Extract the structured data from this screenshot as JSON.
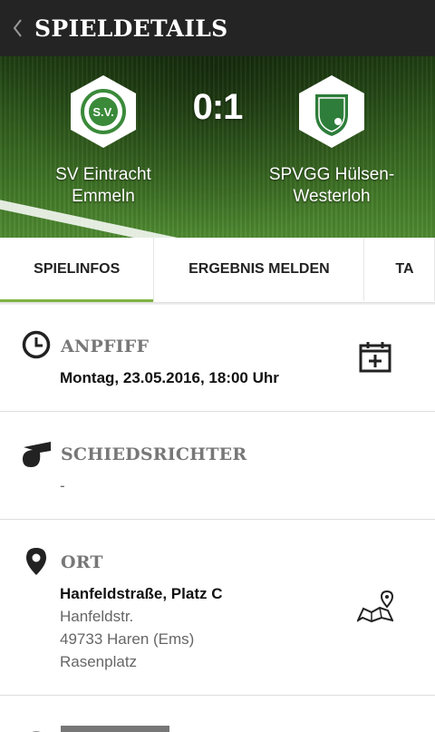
{
  "header": {
    "back_icon": "chevron-left-icon",
    "title": "SPIELDETAILS"
  },
  "match": {
    "home": {
      "name_line1": "SV Eintracht",
      "name_line2": "Emmeln",
      "crest_text": "S.V."
    },
    "away": {
      "name_line1": "SPVGG Hülsen-",
      "name_line2": "Westerloh"
    },
    "score": "0:1"
  },
  "tabs": [
    {
      "label": "SPIELINFOS",
      "active": true
    },
    {
      "label": "ERGEBNIS MELDEN",
      "active": false
    },
    {
      "label": "TA",
      "active": false
    }
  ],
  "colors": {
    "accent": "#7fb241",
    "header_bg": "#242424",
    "home_crest": "#3a8a3a",
    "away_crest": "#2e7d3a"
  },
  "sections": {
    "kickoff": {
      "icon": "clock-icon",
      "heading": "ANPFIFF",
      "value": "Montag, 23.05.2016, 18:00 Uhr",
      "action_icon": "calendar-add-icon"
    },
    "referee": {
      "icon": "whistle-icon",
      "heading": "SCHIEDSRICHTER",
      "value": "-"
    },
    "location": {
      "icon": "map-pin-icon",
      "heading": "ORT",
      "value": "Hanfeldstraße, Platz C",
      "street": "Hanfeldstr.",
      "city": "49733 Haren (Ems)",
      "surface": "Rasenplatz",
      "action_icon": "map-navigation-icon"
    }
  }
}
